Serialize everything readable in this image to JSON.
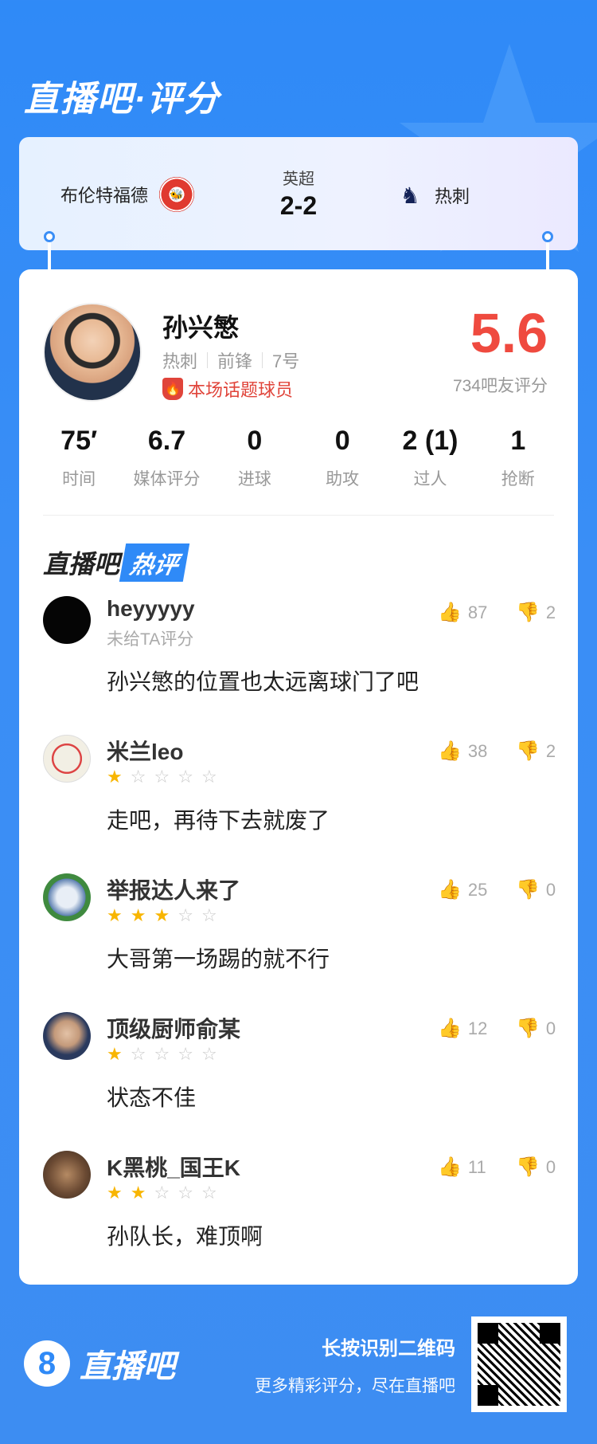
{
  "header": {
    "title": "直播吧·评分"
  },
  "match": {
    "home_team": "布伦特福德",
    "away_team": "热刺",
    "league": "英超",
    "score": "2-2"
  },
  "player": {
    "name": "孙兴慜",
    "team": "热刺",
    "position": "前锋",
    "number": "7号",
    "hot_badge": "本场话题球员",
    "rating": "5.6",
    "rating_count": "734吧友评分"
  },
  "stats": [
    {
      "value": "75′",
      "label": "时间"
    },
    {
      "value": "6.7",
      "label": "媒体评分"
    },
    {
      "value": "0",
      "label": "进球"
    },
    {
      "value": "0",
      "label": "助攻"
    },
    {
      "value": "2 (1)",
      "label": "过人"
    },
    {
      "value": "1",
      "label": "抢断"
    }
  ],
  "hot_comments": {
    "title_a": "直播吧",
    "title_b": "热评",
    "items": [
      {
        "user": "heyyyyy",
        "sub": "未给TA评分",
        "stars": 0,
        "text": "孙兴慜的位置也太远离球门了吧",
        "likes": "87",
        "dislikes": "2"
      },
      {
        "user": "米兰leo",
        "sub": "",
        "stars": 1,
        "text": "走吧，再待下去就废了",
        "likes": "38",
        "dislikes": "2"
      },
      {
        "user": "举报达人来了",
        "sub": "",
        "stars": 3,
        "text": "大哥第一场踢的就不行",
        "likes": "25",
        "dislikes": "0"
      },
      {
        "user": "顶级厨师俞某",
        "sub": "",
        "stars": 1,
        "text": "状态不佳",
        "likes": "12",
        "dislikes": "0"
      },
      {
        "user": "K黑桃_国王K",
        "sub": "",
        "stars": 2,
        "text": "孙队长，难顶啊",
        "likes": "11",
        "dislikes": "0"
      }
    ]
  },
  "footer": {
    "logo_mark": "8",
    "logo_text": "直播吧",
    "cta_primary": "长按识别二维码",
    "cta_secondary": "更多精彩评分，尽在直播吧"
  },
  "colors": {
    "brand_blue": "#2f8af7",
    "rating_red": "#ef4a3f",
    "star_gold": "#f8b500"
  }
}
